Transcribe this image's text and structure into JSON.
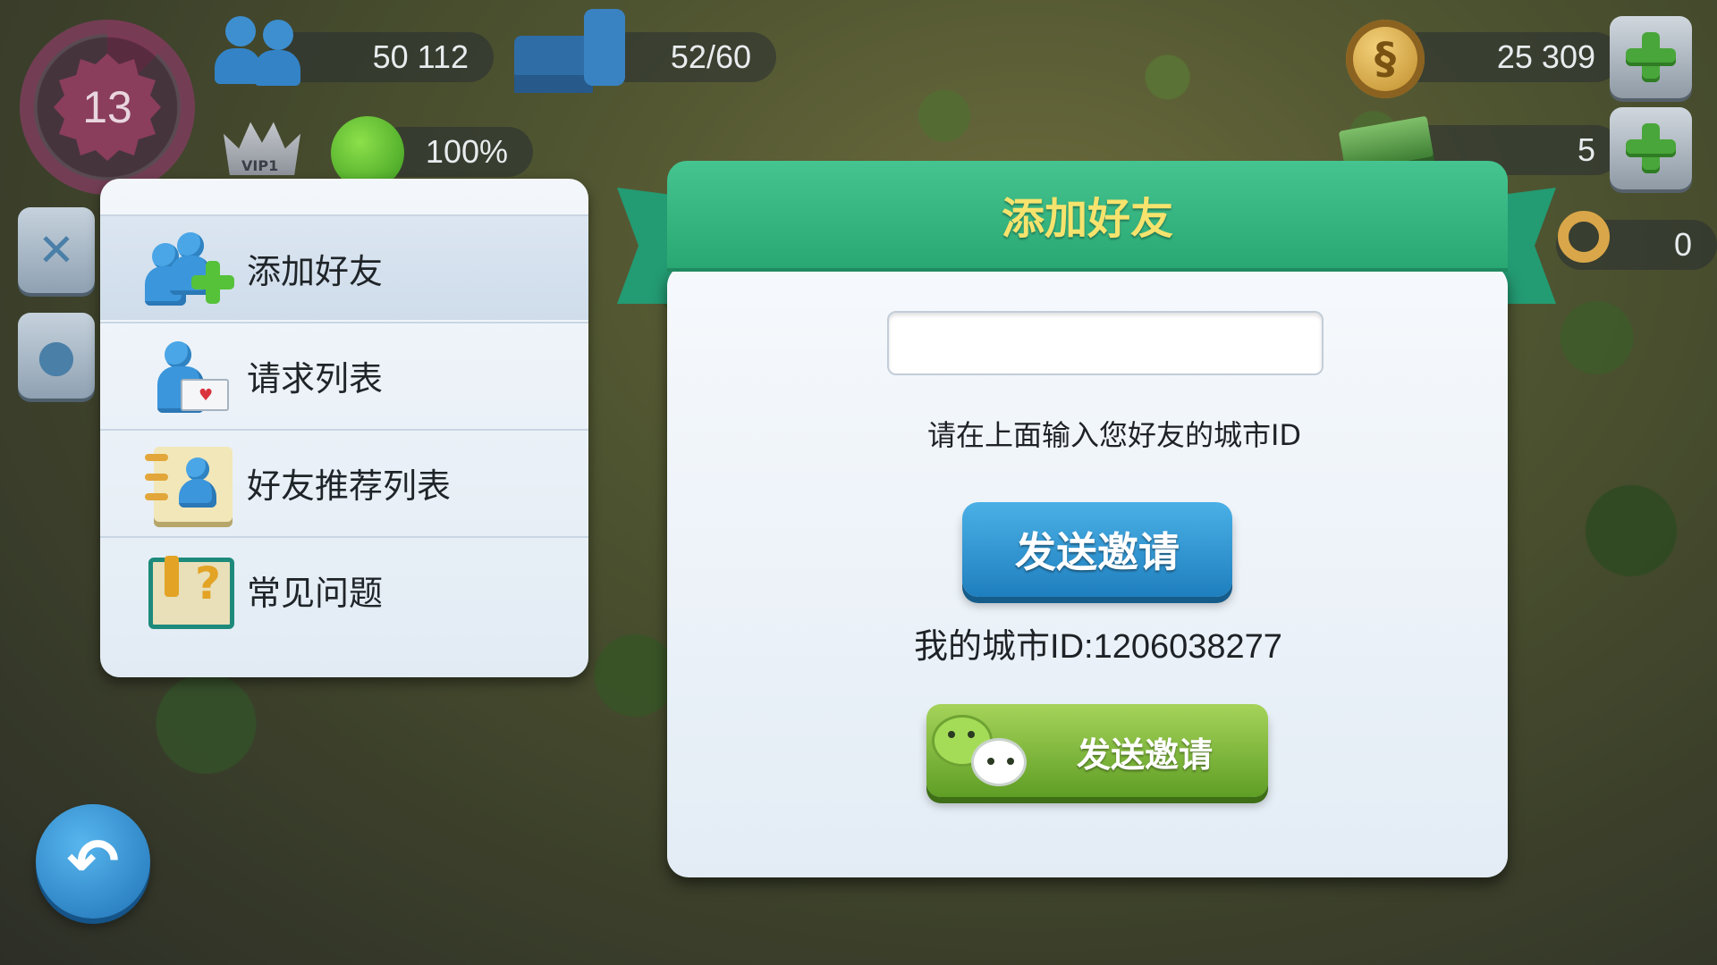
{
  "hud": {
    "level": "13",
    "population": "50 112",
    "storage": "52/60",
    "happiness": "100%",
    "vip": "VIP1",
    "simoleons": "25 309",
    "simcash": "5",
    "keys": "0"
  },
  "menu": {
    "items": [
      {
        "label": "添加好友",
        "icon": "add-friend-icon"
      },
      {
        "label": "请求列表",
        "icon": "request-list-icon"
      },
      {
        "label": "好友推荐列表",
        "icon": "friend-recommendation-icon"
      },
      {
        "label": "常见问题",
        "icon": "faq-icon"
      }
    ]
  },
  "dialog": {
    "title": "添加好友",
    "input_value": "",
    "hint": "请在上面输入您好友的城市ID",
    "send_button": "发送邀请",
    "my_city_id": "我的城市ID:1206038277",
    "wechat_button": "发送邀请"
  },
  "colors": {
    "ribbon_green": "#2aa874",
    "title_yellow": "#f6e36d",
    "send_blue": "#1f7fbe",
    "wechat_green": "#5f9e25"
  }
}
